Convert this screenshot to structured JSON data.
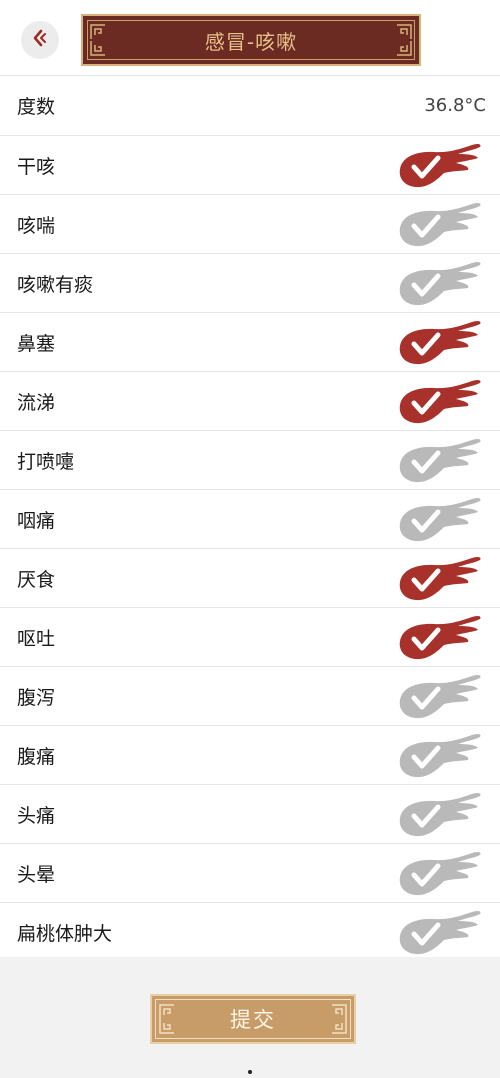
{
  "header": {
    "title": "感冒-咳嗽",
    "back_icon": "back-arrow-icon"
  },
  "temperature": {
    "label": "度数",
    "value": "36.8°C"
  },
  "symptoms": [
    {
      "label": "干咳",
      "checked": true
    },
    {
      "label": "咳喘",
      "checked": false
    },
    {
      "label": "咳嗽有痰",
      "checked": false
    },
    {
      "label": "鼻塞",
      "checked": true
    },
    {
      "label": "流涕",
      "checked": true
    },
    {
      "label": "打喷嚏",
      "checked": false
    },
    {
      "label": "咽痛",
      "checked": false
    },
    {
      "label": "厌食",
      "checked": true
    },
    {
      "label": "呕吐",
      "checked": true
    },
    {
      "label": "腹泻",
      "checked": false
    },
    {
      "label": "腹痛",
      "checked": false
    },
    {
      "label": "头痛",
      "checked": false
    },
    {
      "label": "头晕",
      "checked": false
    },
    {
      "label": "扁桃体肿大",
      "checked": false
    }
  ],
  "footer": {
    "submit_label": "提交"
  },
  "colors": {
    "checked": "#a8322b",
    "unchecked": "#b9b9b9",
    "banner": "#6b2a22",
    "banner_text": "#e8c089",
    "submit": "#c79c68"
  }
}
